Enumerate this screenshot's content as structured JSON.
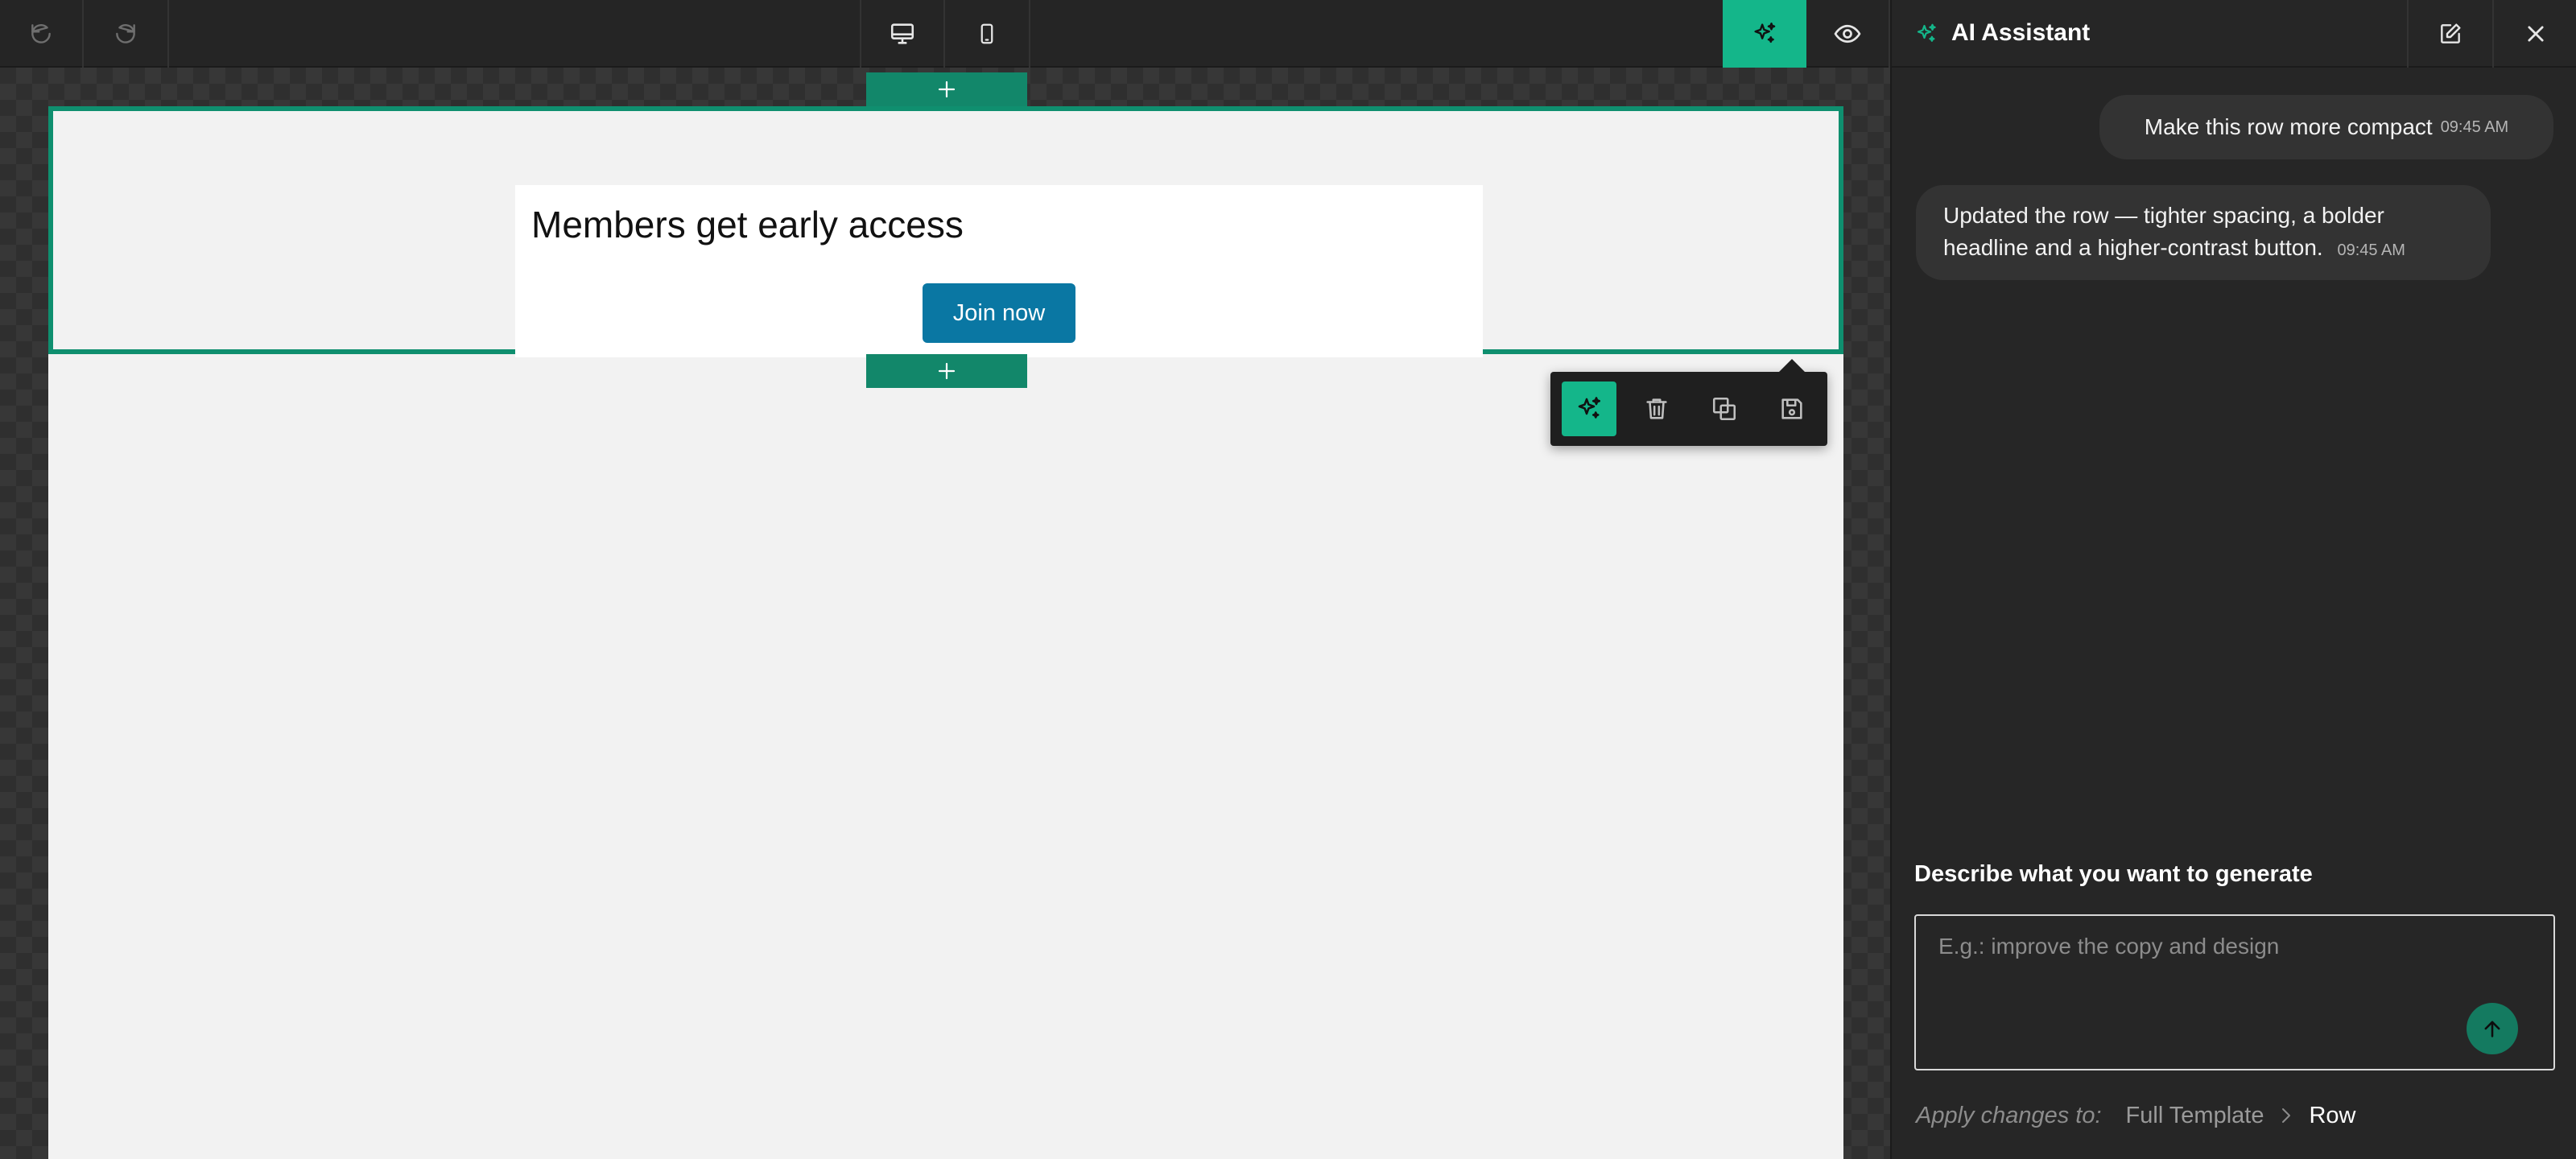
{
  "toolbar": {
    "undo": "undo-icon",
    "redo": "redo-icon",
    "desktop_view": "desktop-icon",
    "mobile_view": "mobile-icon",
    "ai_toggle": "sparkle-icon",
    "preview": "eye-icon"
  },
  "canvas": {
    "row": {
      "headline": "Members get early access",
      "button_label": "Join now"
    },
    "add_row_symbol": "+",
    "row_actions": [
      "sparkle-icon",
      "trash-icon",
      "duplicate-icon",
      "save-icon"
    ]
  },
  "panel": {
    "title": "AI Assistant",
    "messages": [
      {
        "role": "user",
        "text": "Make this row more compact",
        "time": "09:45 AM"
      },
      {
        "role": "assistant",
        "text": "Updated the row — tighter spacing, a bolder headline and a higher-contrast button.",
        "time": "09:45 AM"
      }
    ],
    "prompt_label": "Describe what you want to generate",
    "prompt_placeholder": "E.g.: improve the copy and design",
    "apply_label": "Apply changes to:",
    "scope_full": "Full Template",
    "scope_current": "Row"
  },
  "colors": {
    "accent": "#14b68a",
    "selection": "#0f8f6f",
    "cta": "#0a77a3",
    "panel_bg": "#262626"
  }
}
